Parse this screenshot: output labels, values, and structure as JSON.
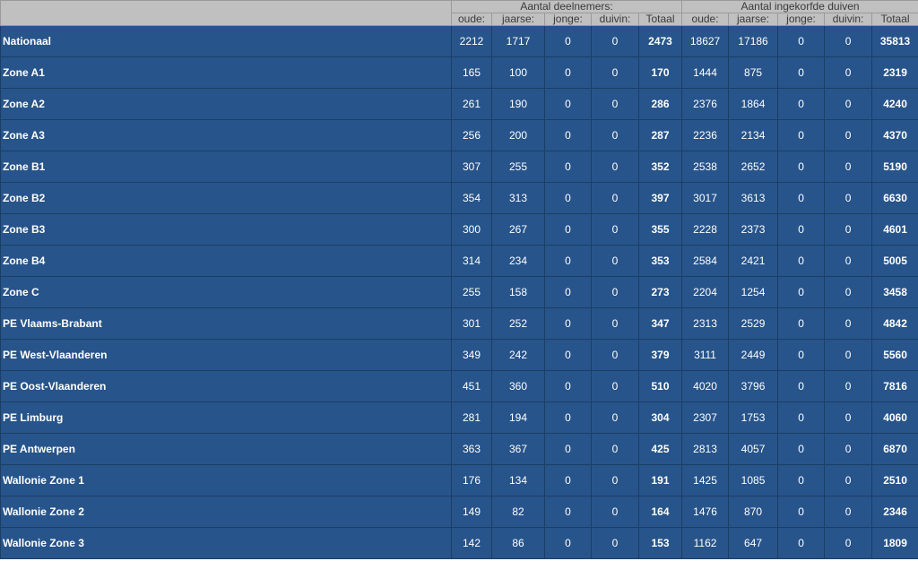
{
  "header": {
    "group_participants": "Aantal deelnemers:",
    "group_pigeons": "Aantal ingekorfde duiven",
    "cols_participants": [
      "oude:",
      "jaarse:",
      "jonge:",
      "duivin:",
      "Totaal"
    ],
    "cols_pigeons": [
      "oude:",
      "jaarse:",
      "jonge:",
      "duivin:",
      "Totaal"
    ]
  },
  "rows": [
    {
      "name": "Nationaal",
      "p": [
        "2212",
        "1717",
        "0",
        "0",
        "2473"
      ],
      "d": [
        "18627",
        "17186",
        "0",
        "0",
        "35813"
      ]
    },
    {
      "name": "Zone A1",
      "p": [
        "165",
        "100",
        "0",
        "0",
        "170"
      ],
      "d": [
        "1444",
        "875",
        "0",
        "0",
        "2319"
      ]
    },
    {
      "name": "Zone A2",
      "p": [
        "261",
        "190",
        "0",
        "0",
        "286"
      ],
      "d": [
        "2376",
        "1864",
        "0",
        "0",
        "4240"
      ]
    },
    {
      "name": "Zone A3",
      "p": [
        "256",
        "200",
        "0",
        "0",
        "287"
      ],
      "d": [
        "2236",
        "2134",
        "0",
        "0",
        "4370"
      ]
    },
    {
      "name": "Zone B1",
      "p": [
        "307",
        "255",
        "0",
        "0",
        "352"
      ],
      "d": [
        "2538",
        "2652",
        "0",
        "0",
        "5190"
      ]
    },
    {
      "name": "Zone B2",
      "p": [
        "354",
        "313",
        "0",
        "0",
        "397"
      ],
      "d": [
        "3017",
        "3613",
        "0",
        "0",
        "6630"
      ]
    },
    {
      "name": "Zone B3",
      "p": [
        "300",
        "267",
        "0",
        "0",
        "355"
      ],
      "d": [
        "2228",
        "2373",
        "0",
        "0",
        "4601"
      ]
    },
    {
      "name": "Zone B4",
      "p": [
        "314",
        "234",
        "0",
        "0",
        "353"
      ],
      "d": [
        "2584",
        "2421",
        "0",
        "0",
        "5005"
      ]
    },
    {
      "name": "Zone C",
      "p": [
        "255",
        "158",
        "0",
        "0",
        "273"
      ],
      "d": [
        "2204",
        "1254",
        "0",
        "0",
        "3458"
      ]
    },
    {
      "name": "PE Vlaams-Brabant",
      "p": [
        "301",
        "252",
        "0",
        "0",
        "347"
      ],
      "d": [
        "2313",
        "2529",
        "0",
        "0",
        "4842"
      ]
    },
    {
      "name": "PE West-Vlaanderen",
      "p": [
        "349",
        "242",
        "0",
        "0",
        "379"
      ],
      "d": [
        "3111",
        "2449",
        "0",
        "0",
        "5560"
      ]
    },
    {
      "name": "PE Oost-Vlaanderen",
      "p": [
        "451",
        "360",
        "0",
        "0",
        "510"
      ],
      "d": [
        "4020",
        "3796",
        "0",
        "0",
        "7816"
      ]
    },
    {
      "name": "PE Limburg",
      "p": [
        "281",
        "194",
        "0",
        "0",
        "304"
      ],
      "d": [
        "2307",
        "1753",
        "0",
        "0",
        "4060"
      ]
    },
    {
      "name": "PE Antwerpen",
      "p": [
        "363",
        "367",
        "0",
        "0",
        "425"
      ],
      "d": [
        "2813",
        "4057",
        "0",
        "0",
        "6870"
      ]
    },
    {
      "name": "Wallonie Zone 1",
      "p": [
        "176",
        "134",
        "0",
        "0",
        "191"
      ],
      "d": [
        "1425",
        "1085",
        "0",
        "0",
        "2510"
      ]
    },
    {
      "name": "Wallonie Zone 2",
      "p": [
        "149",
        "82",
        "0",
        "0",
        "164"
      ],
      "d": [
        "1476",
        "870",
        "0",
        "0",
        "2346"
      ]
    },
    {
      "name": "Wallonie Zone 3",
      "p": [
        "142",
        "86",
        "0",
        "0",
        "153"
      ],
      "d": [
        "1162",
        "647",
        "0",
        "0",
        "1809"
      ]
    }
  ],
  "colors": {
    "row_background": "#27548a",
    "header_background": "#c0c0c0"
  }
}
